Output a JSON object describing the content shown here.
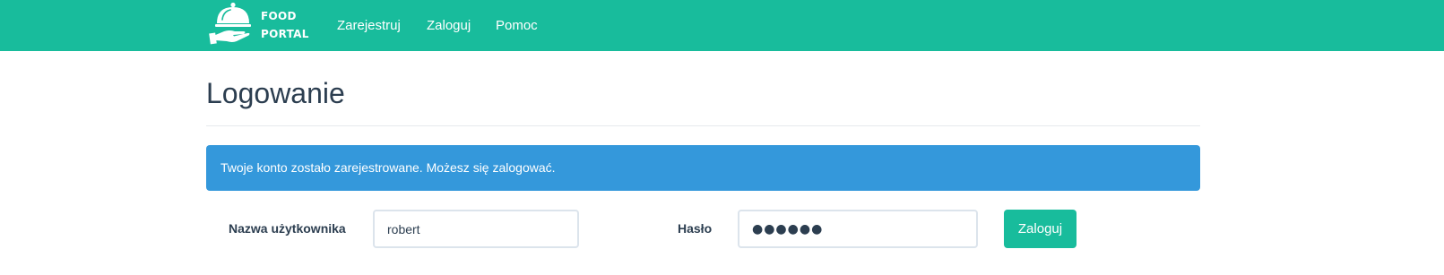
{
  "navbar": {
    "brand": {
      "line1": "FOOD",
      "line2": "PORTAL",
      "logo_icon": "cloche-icon"
    },
    "links": [
      {
        "label": "Zarejestruj"
      },
      {
        "label": "Zaloguj"
      },
      {
        "label": "Pomoc"
      }
    ],
    "background": "#18bc9c"
  },
  "page": {
    "title": "Logowanie"
  },
  "alert": {
    "message": "Twoje konto zostało zarejestrowane. Możesz się zalogować.",
    "color": "#3498db"
  },
  "form": {
    "username_label": "Nazwa użytkownika",
    "username_value": "robert",
    "password_label": "Hasło",
    "password_value": "●●●●●●",
    "submit_label": "Zaloguj"
  }
}
